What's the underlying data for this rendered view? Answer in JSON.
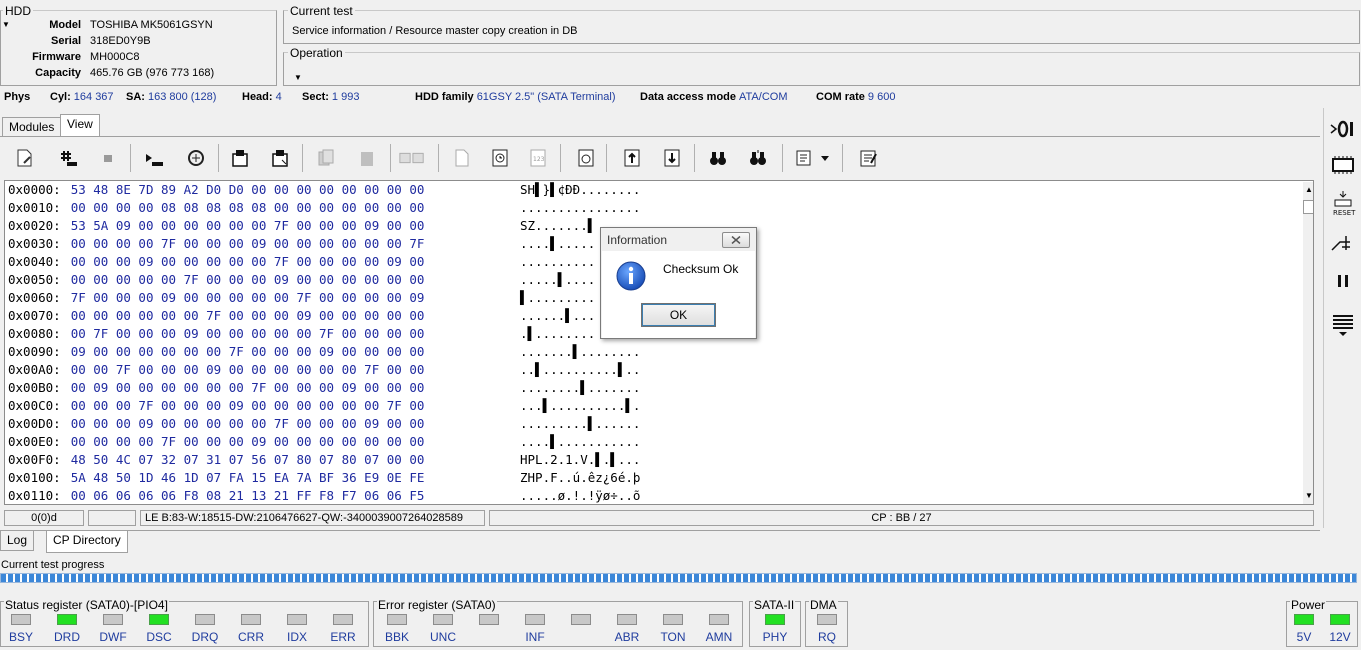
{
  "hdd": {
    "title": "HDD",
    "model_label": "Model",
    "model": "TOSHIBA MK5061GSYN",
    "serial_label": "Serial",
    "serial": "318ED0Y9B",
    "firmware_label": "Firmware",
    "firmware": "MH000C8",
    "capacity_label": "Capacity",
    "capacity": "465.76 GB (976 773 168)"
  },
  "current_test": {
    "title": "Current test",
    "value": "Service information / Resource master copy creation in DB"
  },
  "operation": {
    "title": "Operation",
    "value": ""
  },
  "phys": {
    "label": "Phys",
    "cyl_label": "Cyl:",
    "cyl": "164 367",
    "sa_label": "SA:",
    "sa": "163 800 (128)",
    "head_label": "Head:",
    "head": "4",
    "sect_label": "Sect:",
    "sect": "1 993",
    "family_label": "HDD family",
    "family": "61GSY 2.5\" (SATA Terminal)",
    "access_label": "Data access mode",
    "access": "ATA/COM",
    "com_label": "COM rate",
    "com": "9 600"
  },
  "tabs": {
    "modules": "Modules",
    "view": "View"
  },
  "hex_lines": [
    {
      "off": "0x0000:",
      "bytes": "53 48 8E 7D 89 A2 D0 D0 00 00 00 00 00 00 00 00",
      "ascii": "SH▌}▌¢ÐÐ........"
    },
    {
      "off": "0x0010:",
      "bytes": "00 00 00 00 08 08 08 08 08 00 00 00 00 00 00 00",
      "ascii": "................"
    },
    {
      "off": "0x0020:",
      "bytes": "53 5A 09 00 00 00 00 00 00 7F 00 00 00 09 00 00",
      "ascii": "SZ.......▌"
    },
    {
      "off": "0x0030:",
      "bytes": "00 00 00 00 7F 00 00 00 09 00 00 00 00 00 00 7F",
      "ascii": "....▌....."
    },
    {
      "off": "0x0040:",
      "bytes": "00 00 00 09 00 00 00 00 00 7F 00 00 00 00 09 00",
      "ascii": ".........."
    },
    {
      "off": "0x0050:",
      "bytes": "00 00 00 00 00 7F 00 00 00 09 00 00 00 00 00 00",
      "ascii": ".....▌...."
    },
    {
      "off": "0x0060:",
      "bytes": "7F 00 00 00 09 00 00 00 00 00 7F 00 00 00 00 09",
      "ascii": "▌........."
    },
    {
      "off": "0x0070:",
      "bytes": "00 00 00 00 00 00 7F 00 00 00 09 00 00 00 00 00",
      "ascii": "......▌..."
    },
    {
      "off": "0x0080:",
      "bytes": "00 7F 00 00 00 09 00 00 00 00 00 7F 00 00 00 00",
      "ascii": ".▌........"
    },
    {
      "off": "0x0090:",
      "bytes": "09 00 00 00 00 00 00 7F 00 00 00 09 00 00 00 00",
      "ascii": ".......▌........"
    },
    {
      "off": "0x00A0:",
      "bytes": "00 00 7F 00 00 00 09 00 00 00 00 00 00 7F 00 00",
      "ascii": "..▌..........▌.."
    },
    {
      "off": "0x00B0:",
      "bytes": "00 09 00 00 00 00 00 00 7F 00 00 00 09 00 00 00",
      "ascii": "........▌......."
    },
    {
      "off": "0x00C0:",
      "bytes": "00 00 00 7F 00 00 00 09 00 00 00 00 00 00 7F 00",
      "ascii": "...▌..........▌."
    },
    {
      "off": "0x00D0:",
      "bytes": "00 00 00 09 00 00 00 00 00 7F 00 00 00 09 00 00",
      "ascii": ".........▌......"
    },
    {
      "off": "0x00E0:",
      "bytes": "00 00 00 00 7F 00 00 00 09 00 00 00 00 00 00 00",
      "ascii": "....▌..........."
    },
    {
      "off": "0x00F0:",
      "bytes": "48 50 4C 07 32 07 31 07 56 07 80 07 80 07 00 00",
      "ascii": "HPL.2.1.V.▌.▌..."
    },
    {
      "off": "0x0100:",
      "bytes": "5A 48 50 1D 46 1D 07 FA 15 EA 7A BF 36 E9 0E FE",
      "ascii": "ZHP.F..ú.êz¿6é.þ"
    },
    {
      "off": "0x0110:",
      "bytes": "00 06 06 06 06 F8 08 21 13 21 FF F8 F7 06 06 F5",
      "ascii": ".....ø.!.!ÿø÷..õ"
    }
  ],
  "statusbar": {
    "cell1": "0(0)d",
    "cell2": "",
    "cell3": "LE B:83-W:18515-DW:2106476627-QW:-3400039007264028589",
    "cell4": "CP : BB / 27"
  },
  "bottom_tabs": {
    "log": "Log",
    "cp_directory": "CP Directory"
  },
  "progress": {
    "label": "Current test progress"
  },
  "status_register": {
    "title": "Status register (SATA0)-[PIO4]",
    "leds": [
      {
        "label": "BSY",
        "on": false
      },
      {
        "label": "DRD",
        "on": true
      },
      {
        "label": "DWF",
        "on": false
      },
      {
        "label": "DSC",
        "on": true
      },
      {
        "label": "DRQ",
        "on": false
      },
      {
        "label": "CRR",
        "on": false
      },
      {
        "label": "IDX",
        "on": false
      },
      {
        "label": "ERR",
        "on": false
      }
    ]
  },
  "error_register": {
    "title": "Error register (SATA0)",
    "leds": [
      {
        "label": "BBK",
        "on": false
      },
      {
        "label": "UNC",
        "on": false
      },
      {
        "label": "",
        "on": false
      },
      {
        "label": "INF",
        "on": false
      },
      {
        "label": "",
        "on": false
      },
      {
        "label": "ABR",
        "on": false
      },
      {
        "label": "TON",
        "on": false
      },
      {
        "label": "AMN",
        "on": false
      }
    ]
  },
  "sata": {
    "title": "SATA-II",
    "label": "PHY",
    "on": true
  },
  "dma": {
    "title": "DMA",
    "label": "RQ",
    "on": false
  },
  "power": {
    "title": "Power",
    "leds": [
      {
        "label": "5V",
        "on": true
      },
      {
        "label": "12V",
        "on": true
      }
    ]
  },
  "dialog": {
    "title": "Information",
    "message": "Checksum Ok",
    "ok_label": "OK"
  },
  "colors": {
    "value_blue": "#1f3c9e",
    "led_on": "#22e022",
    "led_off": "#c8c8c8",
    "progress": "#3c87d8"
  }
}
